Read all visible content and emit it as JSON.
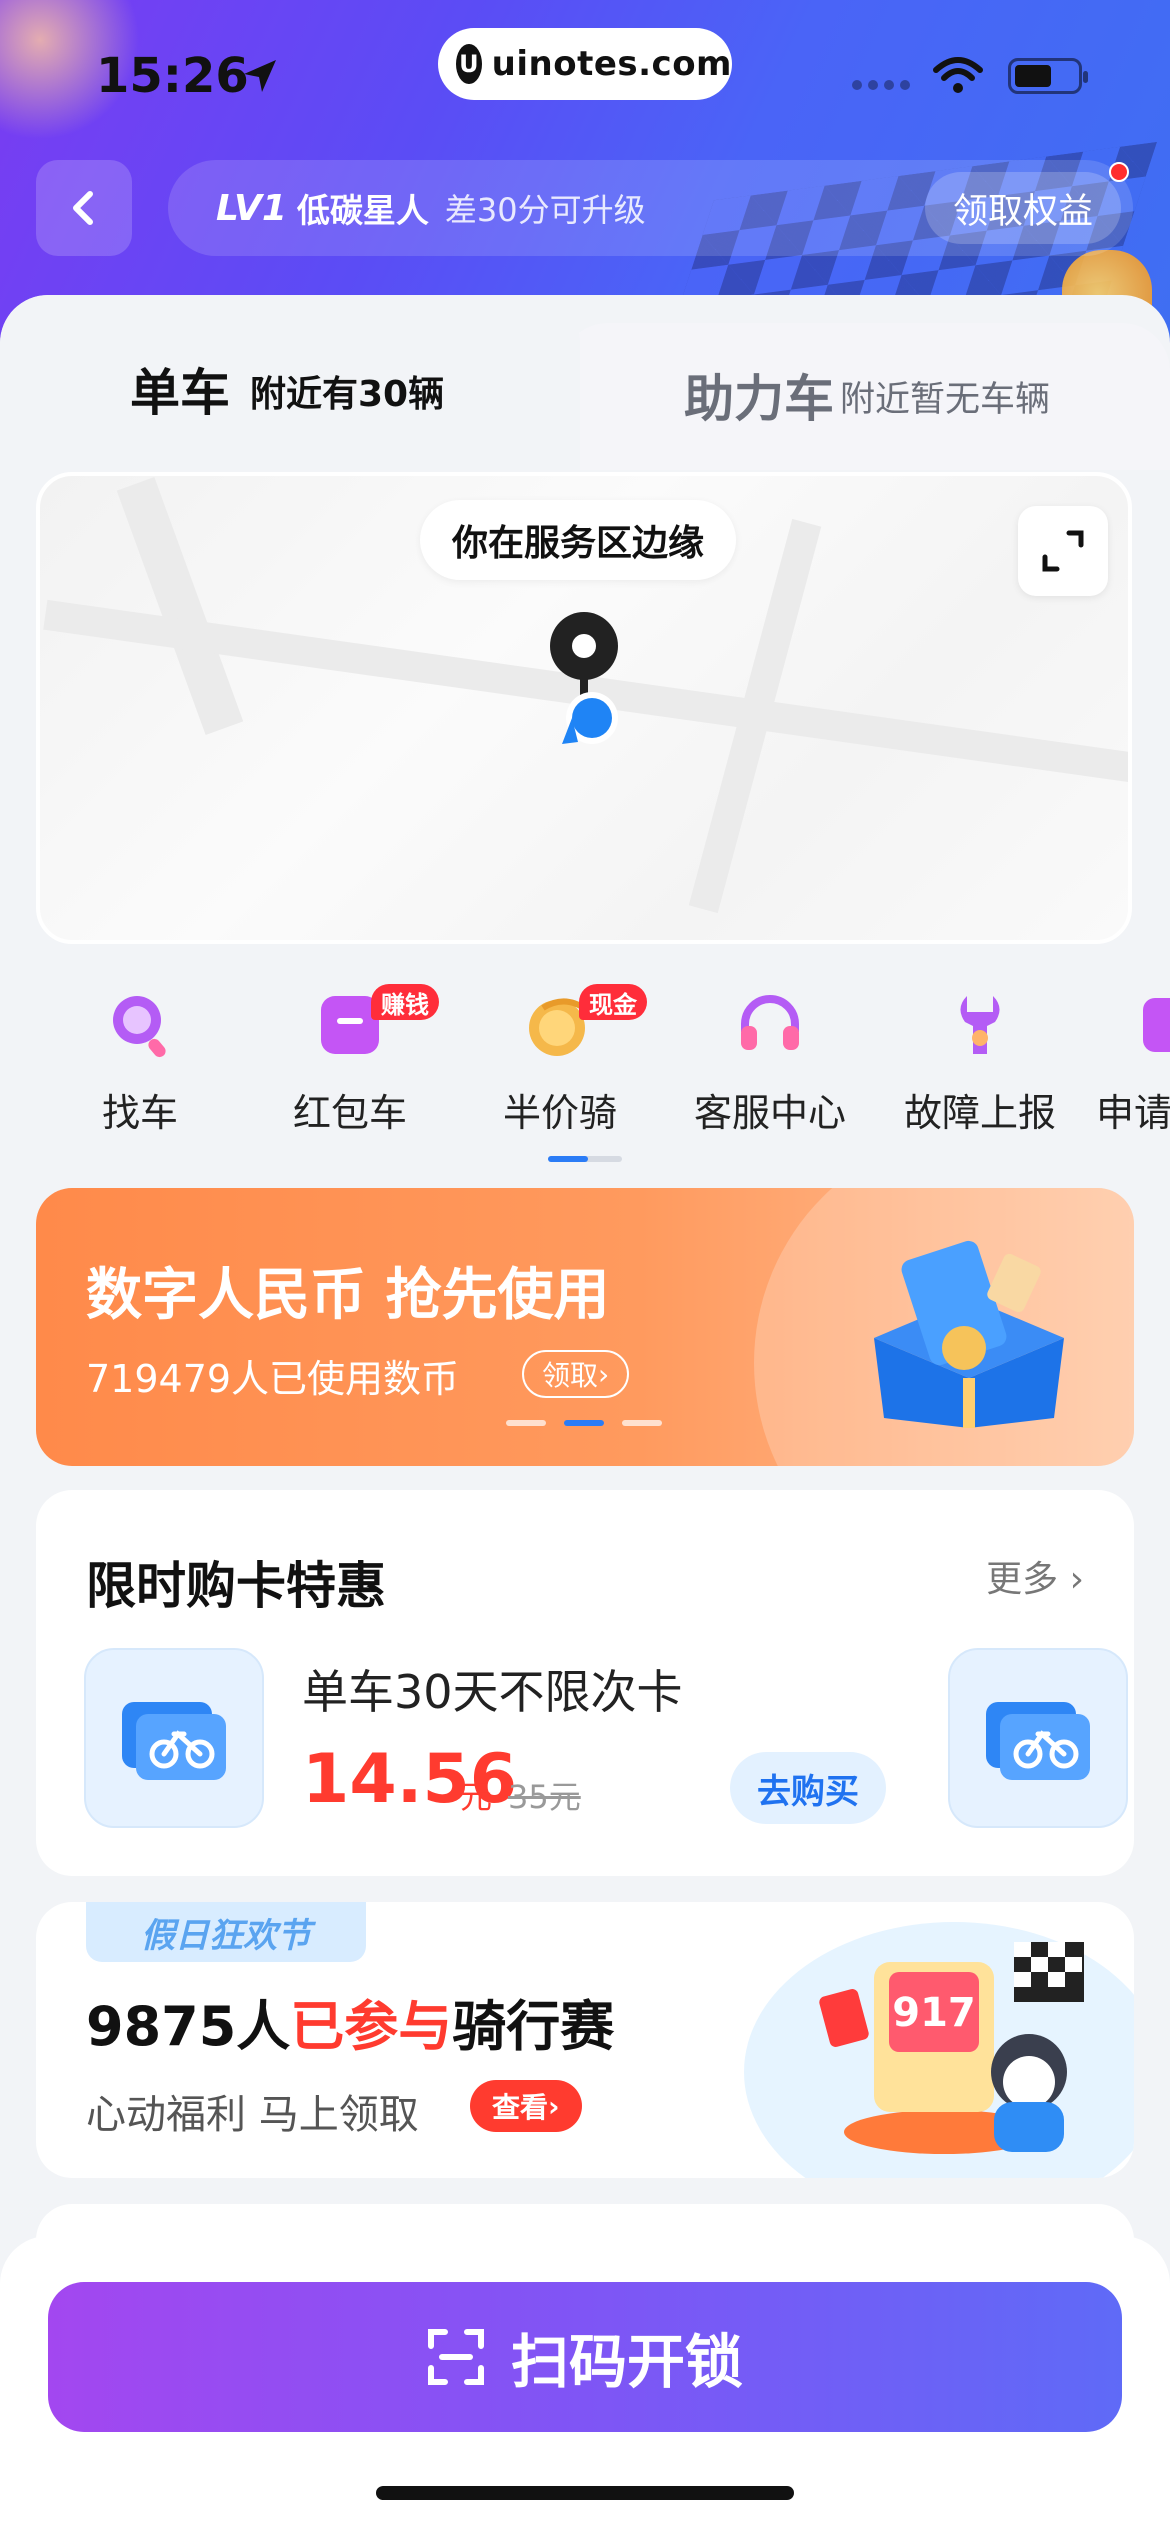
{
  "status_bar": {
    "time": "15:26",
    "brand": "uinotes.com"
  },
  "level": {
    "badge": "LV1",
    "name": "低碳星人",
    "hint": "差30分可升级",
    "claim_label": "领取权益"
  },
  "tabs": [
    {
      "title": "单车",
      "sub": "附近有30辆"
    },
    {
      "title": "助力车",
      "sub": "附近暂无车辆"
    }
  ],
  "map": {
    "zone_label": "你在服务区边缘"
  },
  "menu": [
    {
      "label": "找车",
      "icon": "search-icon",
      "badge": ""
    },
    {
      "label": "红包车",
      "icon": "red-envelope-icon",
      "badge": "赚钱"
    },
    {
      "label": "半价骑",
      "icon": "coin-icon",
      "badge": "现金"
    },
    {
      "label": "客服中心",
      "icon": "headset-icon",
      "badge": ""
    },
    {
      "label": "故障上报",
      "icon": "wrench-icon",
      "badge": ""
    },
    {
      "label": "申请",
      "icon": "apply-icon",
      "badge": ""
    }
  ],
  "promo": {
    "title": "数字人民币 抢先使用",
    "subtitle": "719479人已使用数币",
    "button": "领取"
  },
  "offer": {
    "title": "限时购卡特惠",
    "more": "更多",
    "name": "单车30天不限次卡",
    "price": "14.56",
    "price_unit": "元",
    "price_old": "35元",
    "buy": "去购买"
  },
  "contest": {
    "tag": "假日狂欢节",
    "title_prefix": "9875人",
    "title_highlight": "已参与",
    "title_suffix": "骑行赛",
    "subtitle": "心动福利 马上领取",
    "button": "查看",
    "art_amount": "917"
  },
  "bottom": {
    "scan_label": "扫码开锁"
  },
  "colors": {
    "accent_blue": "#2b7cf6",
    "price_red": "#ff3b2f",
    "scan_start": "#a347f0",
    "scan_end": "#5f6af7"
  }
}
